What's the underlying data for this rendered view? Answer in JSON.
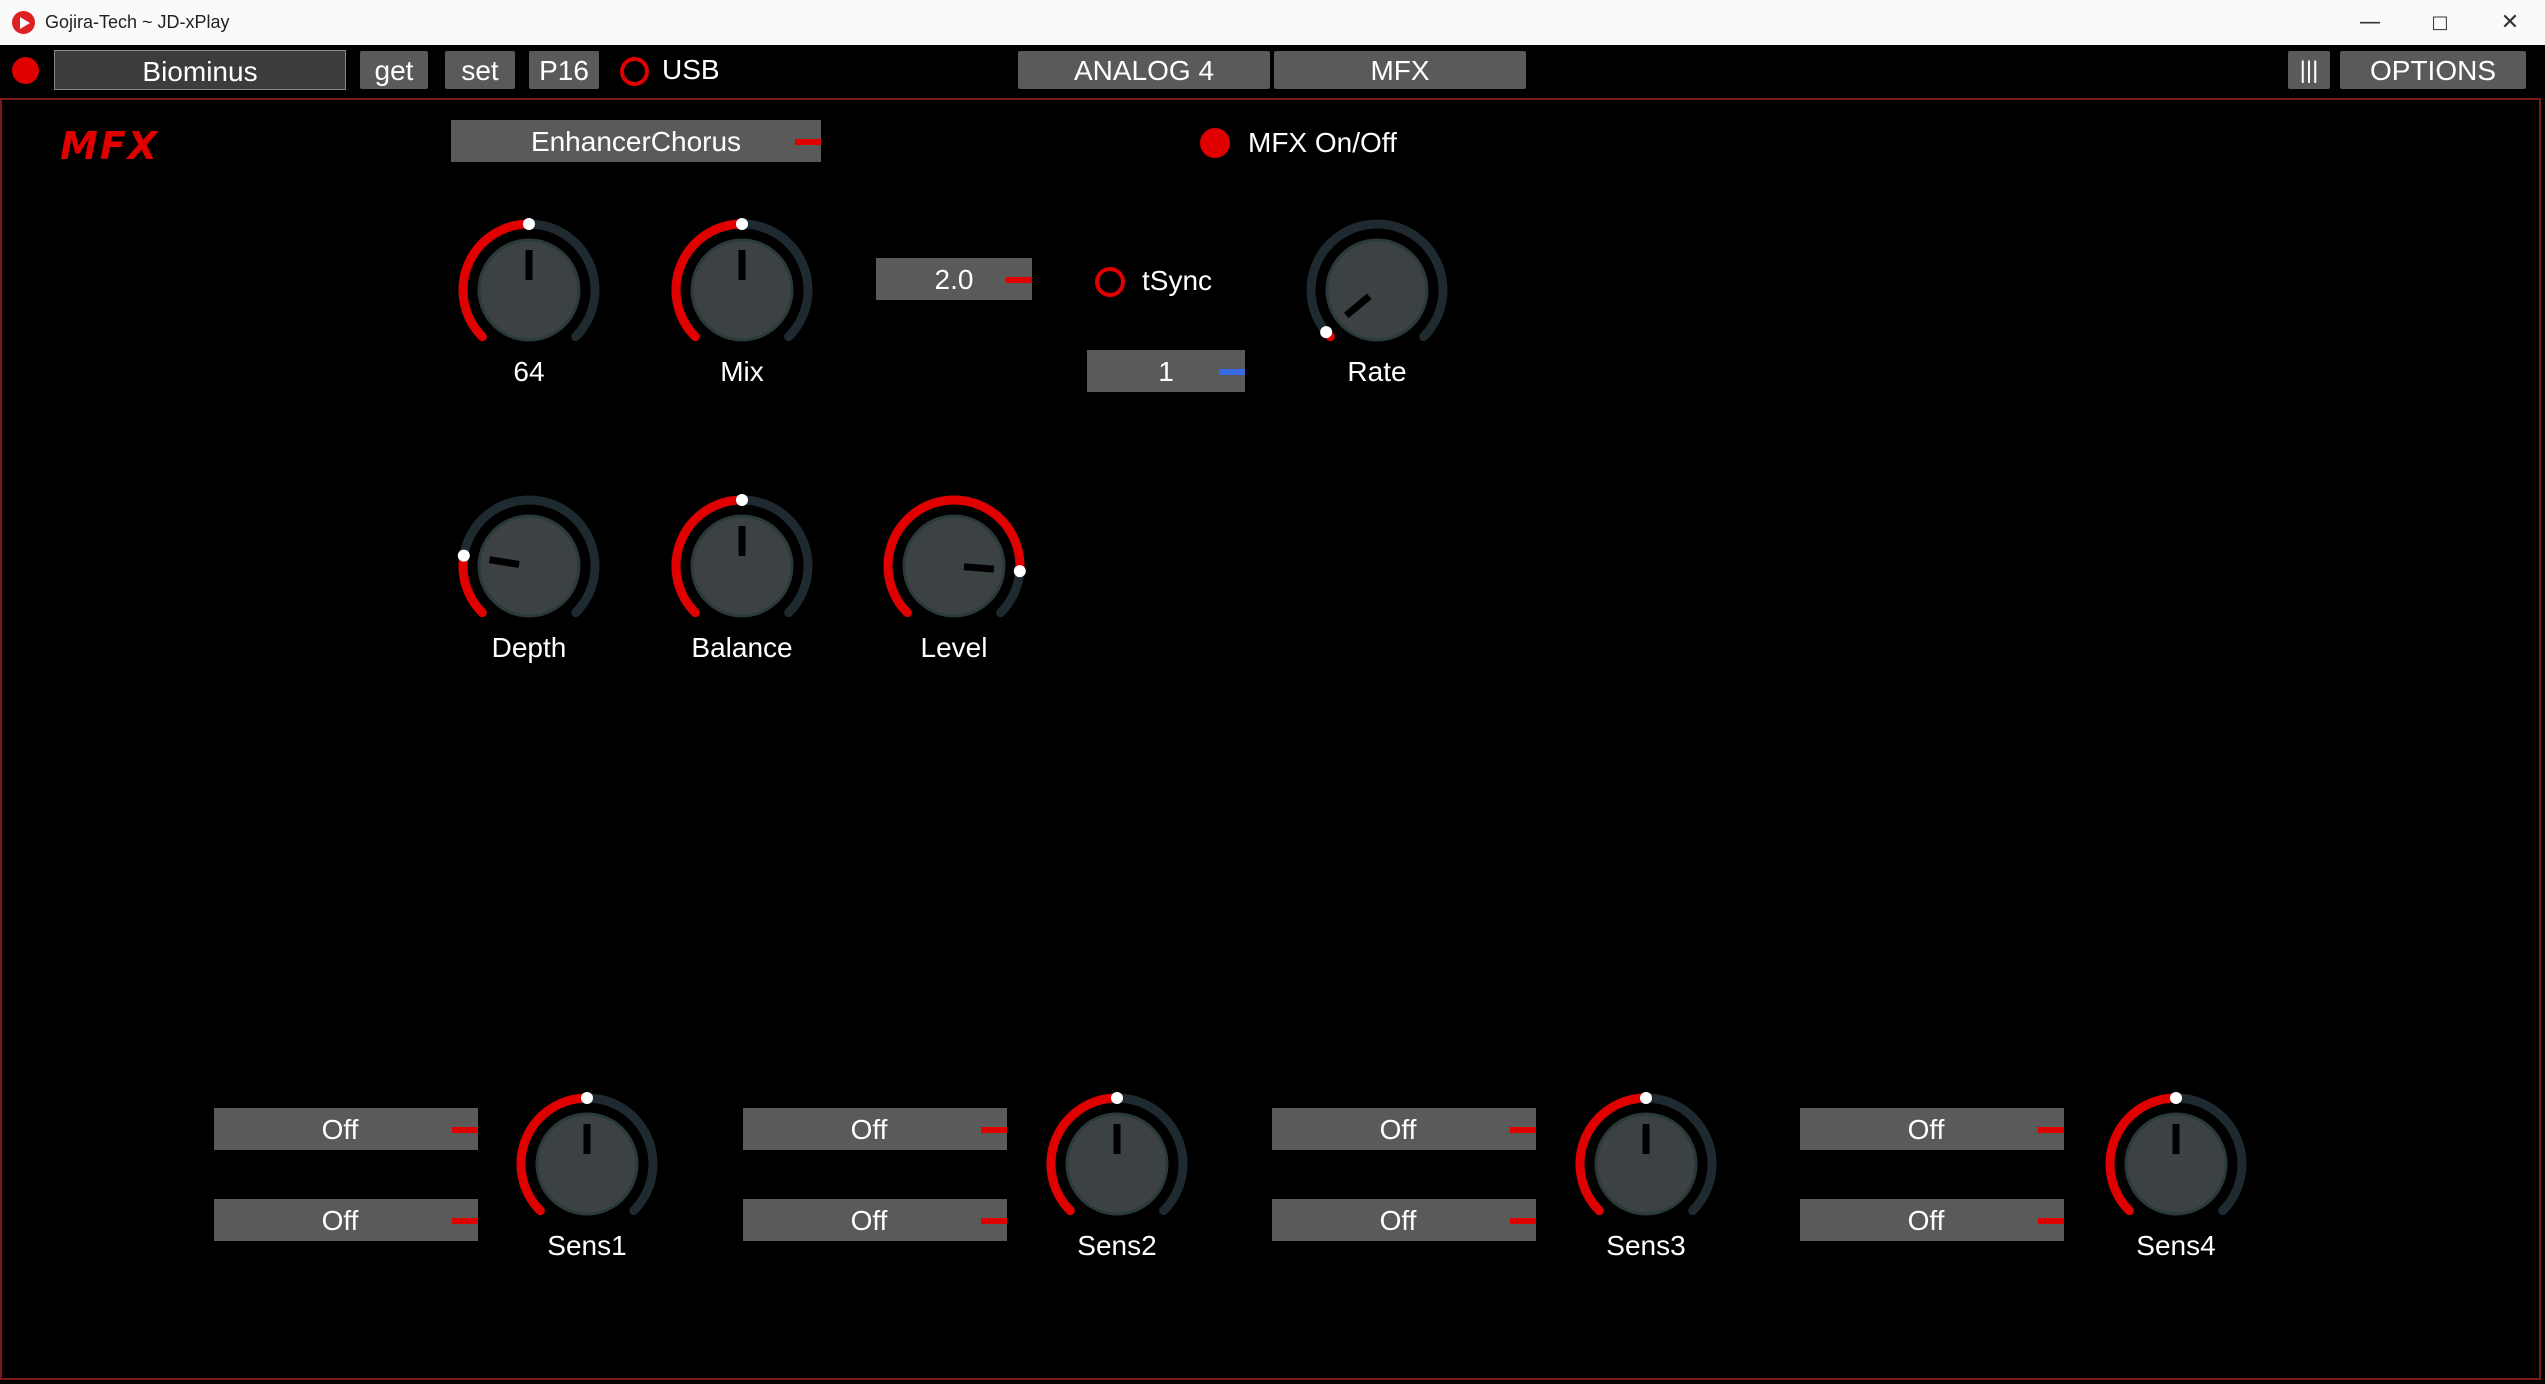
{
  "window": {
    "title": "Gojira-Tech ~ JD-xPlay",
    "minimize": "—",
    "maximize": "□",
    "close": "✕"
  },
  "toolbar": {
    "patch_name": "Biominus",
    "get_label": "get",
    "set_label": "set",
    "part_label": "P16",
    "usb_label": "USB",
    "tab_analog": "ANALOG 4",
    "tab_mfx": "MFX",
    "menu_label": "|||",
    "options_label": "OPTIONS"
  },
  "mfx": {
    "logo": "MFX",
    "type": "EnhancerChorus",
    "onoff_label": "MFX On/Off",
    "rate_value": "2.0",
    "tsync_label": "tSync",
    "tsync_value": "1",
    "knobs": {
      "sens": {
        "label": "64",
        "value": 0.5
      },
      "mix": {
        "label": "Mix",
        "value": 0.5
      },
      "rate": {
        "label": "Rate",
        "value": 0.02
      },
      "depth": {
        "label": "Depth",
        "value": 0.2
      },
      "balance": {
        "label": "Balance",
        "value": 0.5
      },
      "level": {
        "label": "Level",
        "value": 0.85
      }
    },
    "sens_groups": [
      {
        "src1": "Off",
        "src2": "Off",
        "label": "Sens1",
        "value": 0.5
      },
      {
        "src1": "Off",
        "src2": "Off",
        "label": "Sens2",
        "value": 0.5
      },
      {
        "src1": "Off",
        "src2": "Off",
        "label": "Sens3",
        "value": 0.5
      },
      {
        "src1": "Off",
        "src2": "Off",
        "label": "Sens4",
        "value": 0.5
      }
    ]
  },
  "colors": {
    "accent": "#e00000",
    "track": "#1e2a30",
    "knob_body": "#3c4244",
    "tsync_tick": "#3a6ae0"
  }
}
